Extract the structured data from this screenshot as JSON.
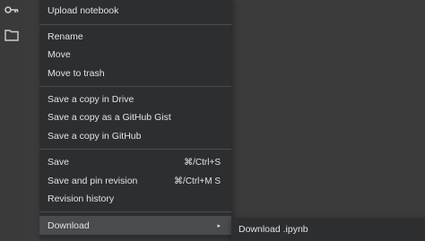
{
  "rail": {
    "icons": [
      "key-icon",
      "folder-icon"
    ]
  },
  "menu": {
    "items": [
      {
        "label": "Upload notebook",
        "shortcut": ""
      },
      {
        "label": "Rename",
        "shortcut": ""
      },
      {
        "label": "Move",
        "shortcut": ""
      },
      {
        "label": "Move to trash",
        "shortcut": ""
      },
      {
        "label": "Save a copy in Drive",
        "shortcut": ""
      },
      {
        "label": "Save a copy as a GitHub Gist",
        "shortcut": ""
      },
      {
        "label": "Save a copy in GitHub",
        "shortcut": ""
      },
      {
        "label": "Save",
        "shortcut": "⌘/Ctrl+S"
      },
      {
        "label": "Save and pin revision",
        "shortcut": "⌘/Ctrl+M S"
      },
      {
        "label": "Revision history",
        "shortcut": ""
      },
      {
        "label": "Download",
        "shortcut": "▸"
      }
    ]
  },
  "submenu": {
    "items": [
      {
        "label": "Download .ipynb"
      }
    ]
  },
  "colors": {
    "menu_bg": "#2d2e30",
    "page_bg": "#3b3b3b",
    "active_bg": "#4a4b4e",
    "text": "#e3e3e3"
  }
}
